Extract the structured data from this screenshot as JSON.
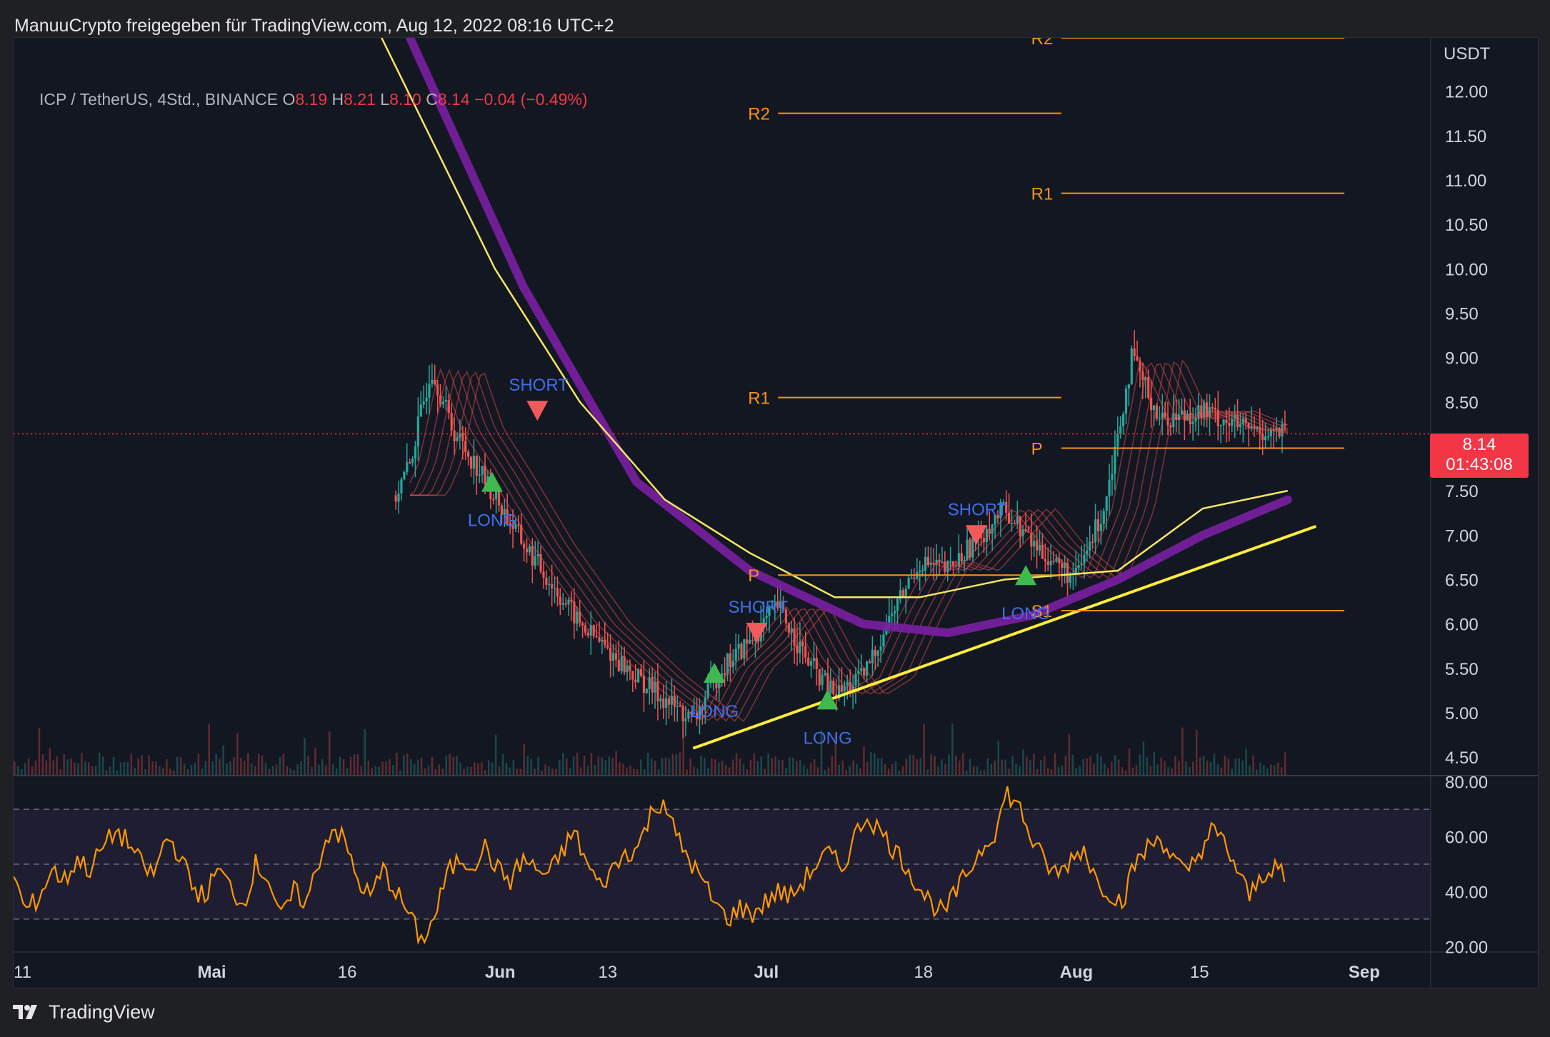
{
  "header": {
    "text": "ManuuCrypto freigegeben für TradingView.com, Aug 12, 2022 08:16 UTC+2"
  },
  "legend": {
    "symbol": "ICP / TetherUS, 4Std., BINANCE",
    "o_label": "O",
    "o_value": "8.19",
    "h_label": "H",
    "h_value": "8.21",
    "l_label": "L",
    "l_value": "8.10",
    "c_label": "C",
    "c_value": "8.14",
    "change": "−0.04 (−0.49%)"
  },
  "price_tag": {
    "price": "8.14",
    "countdown": "01:43:08"
  },
  "footer": {
    "brand": "TradingView"
  },
  "colors": {
    "background": "#131722",
    "up": "#26a69a",
    "down": "#ef5350",
    "pivot": "#f7931a",
    "trendline": "#ffeb3b",
    "ema_long": "#7b1fa2",
    "ema_short": "#f5e663",
    "rsi": "#ff9800",
    "signal_text": "#3f6ee8"
  },
  "chart_data": [
    {
      "type": "candlestick",
      "title": "",
      "y_unit": "USDT",
      "ylim": [
        4.3,
        12.6
      ],
      "y_ticks": [
        "12.00",
        "11.50",
        "11.00",
        "10.50",
        "10.00",
        "9.50",
        "9.00",
        "8.50",
        "8.00",
        "7.50",
        "7.00",
        "6.50",
        "6.00",
        "5.50",
        "5.00",
        "4.50"
      ],
      "x_ticks": [
        "11",
        "Mai",
        "16",
        "Jun",
        "13",
        "Jul",
        "18",
        "Aug",
        "15",
        "Sep"
      ],
      "last_price": 8.14,
      "price_path": [
        {
          "t": 0.0,
          "p": 12.1
        },
        {
          "t": 0.04,
          "p": 12.0
        },
        {
          "t": 0.07,
          "p": 11.2
        },
        {
          "t": 0.1,
          "p": 9.3
        },
        {
          "t": 0.115,
          "p": 6.6
        },
        {
          "t": 0.13,
          "p": 8.0
        },
        {
          "t": 0.16,
          "p": 7.8
        },
        {
          "t": 0.2,
          "p": 8.2
        },
        {
          "t": 0.24,
          "p": 7.4
        },
        {
          "t": 0.26,
          "p": 7.1
        },
        {
          "t": 0.28,
          "p": 7.8
        },
        {
          "t": 0.295,
          "p": 8.9
        },
        {
          "t": 0.31,
          "p": 8.2
        },
        {
          "t": 0.33,
          "p": 7.7
        },
        {
          "t": 0.36,
          "p": 6.9
        },
        {
          "t": 0.4,
          "p": 6.0
        },
        {
          "t": 0.44,
          "p": 5.4
        },
        {
          "t": 0.48,
          "p": 4.9
        },
        {
          "t": 0.5,
          "p": 5.5
        },
        {
          "t": 0.52,
          "p": 5.8
        },
        {
          "t": 0.54,
          "p": 6.2
        },
        {
          "t": 0.56,
          "p": 5.6
        },
        {
          "t": 0.58,
          "p": 5.2
        },
        {
          "t": 0.6,
          "p": 5.4
        },
        {
          "t": 0.62,
          "p": 6.1
        },
        {
          "t": 0.64,
          "p": 6.7
        },
        {
          "t": 0.66,
          "p": 6.6
        },
        {
          "t": 0.7,
          "p": 7.3
        },
        {
          "t": 0.72,
          "p": 6.9
        },
        {
          "t": 0.75,
          "p": 6.5
        },
        {
          "t": 0.77,
          "p": 7.3
        },
        {
          "t": 0.79,
          "p": 9.0
        },
        {
          "t": 0.81,
          "p": 8.3
        },
        {
          "t": 0.84,
          "p": 8.4
        },
        {
          "t": 0.87,
          "p": 8.2
        },
        {
          "t": 0.9,
          "p": 8.14
        }
      ],
      "ema_long_path": [
        {
          "t": 0.28,
          "p": 12.6
        },
        {
          "t": 0.36,
          "p": 9.8
        },
        {
          "t": 0.44,
          "p": 7.6
        },
        {
          "t": 0.52,
          "p": 6.6
        },
        {
          "t": 0.6,
          "p": 6.0
        },
        {
          "t": 0.66,
          "p": 5.9
        },
        {
          "t": 0.72,
          "p": 6.1
        },
        {
          "t": 0.78,
          "p": 6.5
        },
        {
          "t": 0.84,
          "p": 7.0
        },
        {
          "t": 0.9,
          "p": 7.4
        }
      ],
      "ema_short_path": [
        {
          "t": 0.26,
          "p": 12.6
        },
        {
          "t": 0.34,
          "p": 10.0
        },
        {
          "t": 0.4,
          "p": 8.5
        },
        {
          "t": 0.46,
          "p": 7.4
        },
        {
          "t": 0.52,
          "p": 6.8
        },
        {
          "t": 0.58,
          "p": 6.3
        },
        {
          "t": 0.64,
          "p": 6.3
        },
        {
          "t": 0.7,
          "p": 6.5
        },
        {
          "t": 0.78,
          "p": 6.6
        },
        {
          "t": 0.84,
          "p": 7.3
        },
        {
          "t": 0.9,
          "p": 7.5
        }
      ],
      "trendline": {
        "from": {
          "t": 0.48,
          "p": 4.6
        },
        "to": {
          "t": 0.92,
          "p": 7.1
        }
      },
      "pivots": [
        {
          "label": "R2",
          "price": 11.75,
          "from": 0.54,
          "to": 0.74
        },
        {
          "label": "R1",
          "price": 8.55,
          "from": 0.54,
          "to": 0.74
        },
        {
          "label": "P",
          "price": 6.55,
          "from": 0.54,
          "to": 0.74
        },
        {
          "label": "R2",
          "price": 12.6,
          "from": 0.74,
          "to": 0.94
        },
        {
          "label": "R1",
          "price": 10.85,
          "from": 0.74,
          "to": 0.94
        },
        {
          "label": "P",
          "price": 7.98,
          "from": 0.74,
          "to": 0.94
        },
        {
          "label": "S1",
          "price": 6.15,
          "from": 0.74,
          "to": 0.94
        }
      ],
      "signals": [
        {
          "type": "LONG",
          "t": 0.338,
          "p": 7.6
        },
        {
          "type": "SHORT",
          "t": 0.37,
          "p": 8.4
        },
        {
          "type": "LONG",
          "t": 0.495,
          "p": 5.45
        },
        {
          "type": "SHORT",
          "t": 0.525,
          "p": 5.9
        },
        {
          "type": "LONG",
          "t": 0.575,
          "p": 5.15
        },
        {
          "type": "SHORT",
          "t": 0.68,
          "p": 7.0
        },
        {
          "type": "LONG",
          "t": 0.715,
          "p": 6.55
        }
      ]
    },
    {
      "type": "line",
      "title": "",
      "ylim": [
        18,
        82
      ],
      "y_ticks": [
        "80.00",
        "60.00",
        "40.00",
        "20.00"
      ],
      "bands": [
        70,
        50,
        30
      ],
      "series": [
        {
          "values": [
            45,
            33,
            38,
            48,
            44,
            52,
            48,
            56,
            62,
            58,
            50,
            46,
            60,
            54,
            42,
            38,
            48,
            42,
            35,
            50,
            45,
            30,
            40,
            36,
            52,
            64,
            58,
            44,
            38,
            48,
            40,
            32,
            22,
            30,
            46,
            52,
            50,
            56,
            48,
            44,
            52,
            48,
            46,
            54,
            62,
            50,
            42,
            48,
            54,
            56,
            68,
            74,
            60,
            52,
            44,
            36,
            30,
            34,
            32,
            36,
            40,
            38,
            44,
            50,
            54,
            48,
            60,
            68,
            62,
            56,
            50,
            42,
            36,
            32,
            40,
            48,
            56,
            62,
            76,
            70,
            58,
            50,
            46,
            52,
            56,
            44,
            40,
            36,
            50,
            56,
            60,
            52,
            46,
            54,
            62,
            58,
            48,
            38,
            46,
            50,
            42
          ]
        }
      ]
    }
  ]
}
